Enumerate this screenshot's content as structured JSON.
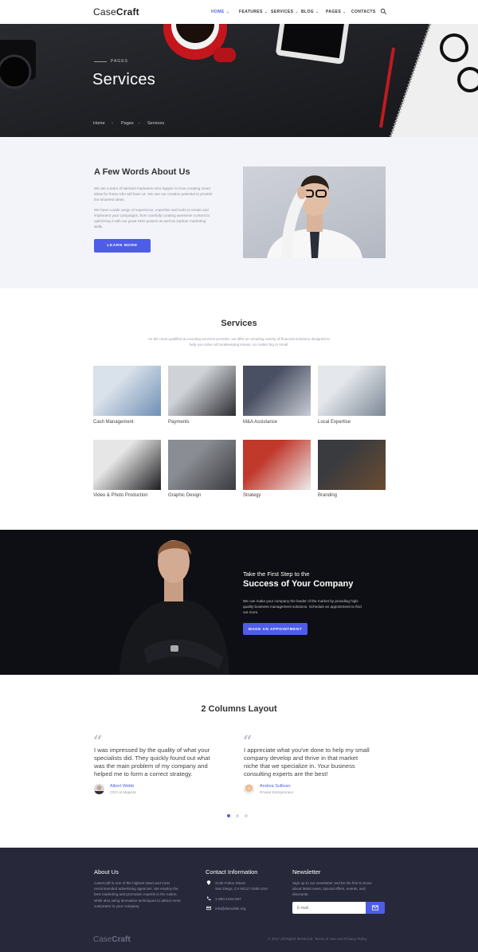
{
  "header": {
    "logo_light": "Case",
    "logo_bold": "Craft",
    "nav": [
      {
        "label": "HOME",
        "active": true
      },
      {
        "label": "FEATURES",
        "active": false
      },
      {
        "label": "SERVICES",
        "active": false
      },
      {
        "label": "BLOG",
        "active": false
      },
      {
        "label": "PAGES",
        "active": false
      },
      {
        "label": "CONTACTS",
        "active": false
      }
    ],
    "search_icon": "search-icon"
  },
  "hero": {
    "kicker": "PAGES",
    "title": "Services",
    "breadcrumb": [
      "Home",
      "Pages",
      "Services"
    ],
    "breadcrumb_sep": "›"
  },
  "about": {
    "title": "A Few Words About Us",
    "paragraph_1": "We are a team of talented marketers who happen to love creating smart ideas for those who will have us. We use our creative potential to provide the smartest ideas.",
    "paragraph_2": "We have a wide range of experience, expertise and tools to create and implement your campaigns, from carefully curating awesome content to optimizing it with our great SEO powers as well as outdoor marketing skills.",
    "button": "LEARN MORE"
  },
  "services": {
    "title": "Services",
    "subtitle": "As the most qualified accounting services provider, we offer an amazing variety of financial solutions designed to help you solve all bookkeeping issues, no matter big or small.",
    "items": [
      {
        "label": "Cash Management",
        "colors": [
          "#6f8fb4",
          "#d9e1ea"
        ]
      },
      {
        "label": "Payments",
        "colors": [
          "#2c2d31",
          "#cfd3d8"
        ]
      },
      {
        "label": "M&A Assistance",
        "colors": [
          "#c9ccd4",
          "#4a5063"
        ]
      },
      {
        "label": "Local Expertise",
        "colors": [
          "#7b8796",
          "#e4e7eb"
        ]
      },
      {
        "label": "Video & Photo Production",
        "colors": [
          "#1d1d20",
          "#e6e6e6"
        ]
      },
      {
        "label": "Graphic Design",
        "colors": [
          "#3a3b40",
          "#8a8d93"
        ]
      },
      {
        "label": "Strategy",
        "colors": [
          "#ececec",
          "#c0392b"
        ]
      },
      {
        "label": "Branding",
        "colors": [
          "#6b4b32",
          "#3a3b3e"
        ]
      }
    ]
  },
  "cta": {
    "kicker": "Take the First Step to the",
    "title": "Success of Your Company",
    "paragraph": "We can make your company the leader of the market by providing high-quality business management solutions. Schedule an appointment to find out more.",
    "button": "MAKE AN APPOINTMENT"
  },
  "testimonials": {
    "title": "2 Columns Layout",
    "quote_mark": "“",
    "items": [
      {
        "quote": "I was impressed by the quality of what your specialists did. They quickly found out what was the main problem of my company and helped me to form a correct strategy.",
        "name": "Albert Webb",
        "role": "CEO at Majestic"
      },
      {
        "quote": "I appreciate what you've done to help my small company develop and thrive in that market niche that we specialize in. Your business consulting experts are the best!",
        "name": "Andrea Sullivan",
        "role": "Private Entrepreneur"
      }
    ],
    "dots": 3,
    "active_dot": 0
  },
  "footer": {
    "about_title": "About Us",
    "about_text": "CaseCraft is one of the highest rated and most recommended advertising agencies. We employ the best marketing and promotion experts in the nation, while also using innovative techniques to attract more customers to your company.",
    "contact_title": "Contact Information",
    "address_line1": "2130 Fulton Street",
    "address_line2": "San Diego, CA 94117-1080 USA",
    "phone": "1-800-1234-567",
    "email": "info@demolink.org",
    "newsletter_title": "Newsletter",
    "newsletter_text": "Sign up to our newsletter and be the first to know about latest news, special offers, events, and discounts.",
    "email_placeholder": "E-mail",
    "logo_light": "Case",
    "logo_bold": "Craft",
    "copyright": "© 2017 All Rights Reserved. Terms of Use and Privacy Policy"
  },
  "colors": {
    "accent": "#4e5de8",
    "footer_bg": "#272839",
    "about_bg": "#f3f4f9",
    "cta_bg": "#0e0f14"
  }
}
